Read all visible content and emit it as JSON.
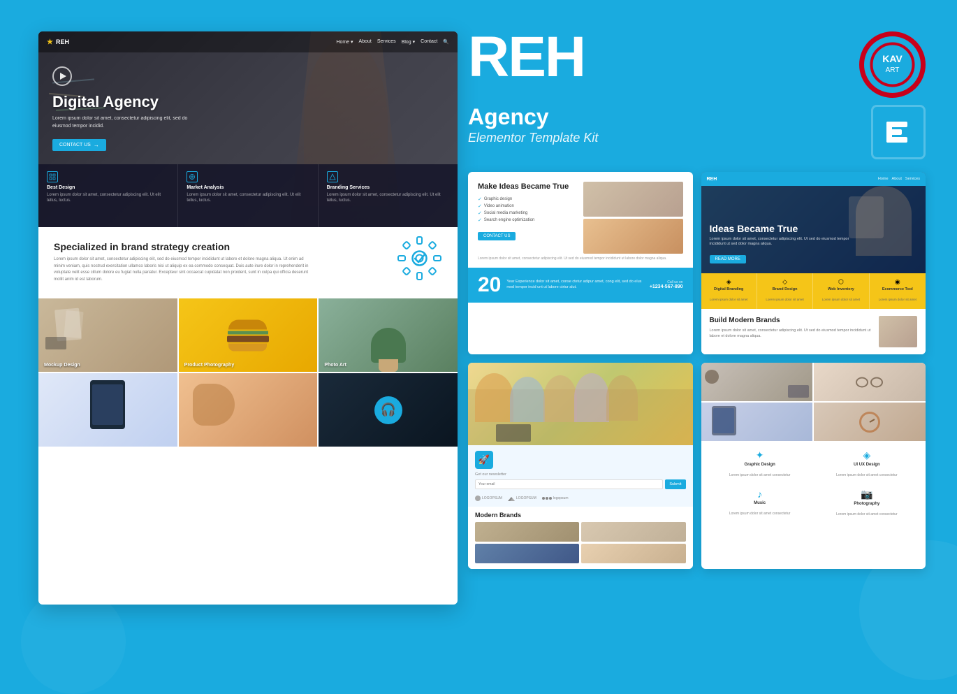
{
  "brand": {
    "name": "REH",
    "category": "Agency",
    "subtitle": "Elementor Template Kit"
  },
  "kavart": {
    "text": "KAV",
    "sub": "ART"
  },
  "website_preview": {
    "nav": {
      "logo": "REH",
      "links": [
        "Home",
        "About",
        "Services",
        "Blog",
        "Contact"
      ]
    },
    "hero": {
      "title": "Digital Agency",
      "description": "Lorem ipsum dolor sit amet, consectetur adipiscing elit, sed do eiusmod tempor incidid.",
      "button": "CONTACT US"
    },
    "features": [
      {
        "title": "Best Design",
        "description": "Lorem ipsum dolor sit amet, consectetur adipiscing elit. Ut elit tellus, luctus."
      },
      {
        "title": "Market Analysis",
        "description": "Lorem ipsum dolor sit amet, consectetur adipiscing elit. Ut elit tellus, luctus."
      },
      {
        "title": "Branding Services",
        "description": "Lorem ipsum dolor sit amet, consectetur adipiscing elit. Ut elit tellus, luctus."
      }
    ],
    "brand_section": {
      "title": "Specialized in brand strategy creation",
      "description": "Lorem ipsum dolor sit amet, consectetur adipiscing elit, sed do eiusmod tempor incididunt ut labore et dolore magna aliqua. Ut enim ad minim veniam, quis nostrud exercitation ullamco laboris nisi ut aliquip ex ea commodo consequat. Duis aute irure dolor in reprehenderit in voluptate velit esse cillum dolore eu fugiat nulla pariatur. Excepteur sint occaecat cupidatat non proident, sunt in culpa qui officia deserunt mollit anim id est laborum."
    },
    "portfolio": [
      {
        "label": "Mockup Design",
        "type": "mockup"
      },
      {
        "label": "Product Photography",
        "type": "product"
      },
      {
        "label": "Photo Art",
        "type": "photo"
      }
    ]
  },
  "card1": {
    "title": "Make Ideas\nBecame True",
    "services": [
      "Graphic design",
      "Video animation",
      "Social media marketing",
      "Search engine optimization"
    ],
    "button": "CONTACT US",
    "stat_number": "20",
    "stat_text": "Year Experience dolor sit amet, conse ctetur adipur amet, cong elit, sed do elus mod tempor incid unt ut labore ctrtur alut.",
    "call_label": "Call us on",
    "phone": "+1234-567-890"
  },
  "card2": {
    "nav_logo": "REH",
    "title": "Ideas Became True",
    "description": "Lorem ipsum dolor sit amet, consectetur adipiscing elit. Ut sed do eiusmod tempor incididunt ut sed dolor magna aliqua.",
    "button": "READ MORE",
    "services": [
      {
        "icon": "◈",
        "name": "Digital Branding",
        "desc": "Lorem ipsum dolor sit amet"
      },
      {
        "icon": "◇",
        "name": "Brand Design",
        "desc": "Lorem ipsum dolor sit amet"
      },
      {
        "icon": "⬡",
        "name": "Web Inventory",
        "desc": "Lorem ipsum dolor sit amet"
      },
      {
        "icon": "◉",
        "name": "Ecommerce Tool",
        "desc": "Lorem ipsum dolor sit amet"
      }
    ],
    "bottom_title": "Build Modern\nBrands",
    "bottom_text": "Lorem ipsum dolor sit amet, consectetur adipiscing elit. Ut sed do eiusmod tempor incididunt ut labore et dolore magna aliqua."
  },
  "card3": {
    "newsletter_label": "Get our newsletter",
    "input_placeholder": "Your email",
    "submit_label": "Submit",
    "logos": [
      "LOGOPSUM",
      "LOGOPSUM",
      "logopsum"
    ],
    "section_title": "Modern Brands"
  },
  "card4": {
    "services": [
      {
        "icon": "✦",
        "name": "Graphic Design",
        "desc": "Lorem ipsum dolor sit amet consectetur"
      },
      {
        "icon": "◈",
        "name": "UI UX Design",
        "desc": "Lorem ipsum dolor sit amet consectetur"
      },
      {
        "icon": "♪",
        "name": "Music",
        "desc": "Lorem ipsum dolor sit amet consectetur"
      },
      {
        "icon": "📷",
        "name": "Photography",
        "desc": "Lorem ipsum dolor sit amet consectetur"
      }
    ]
  }
}
